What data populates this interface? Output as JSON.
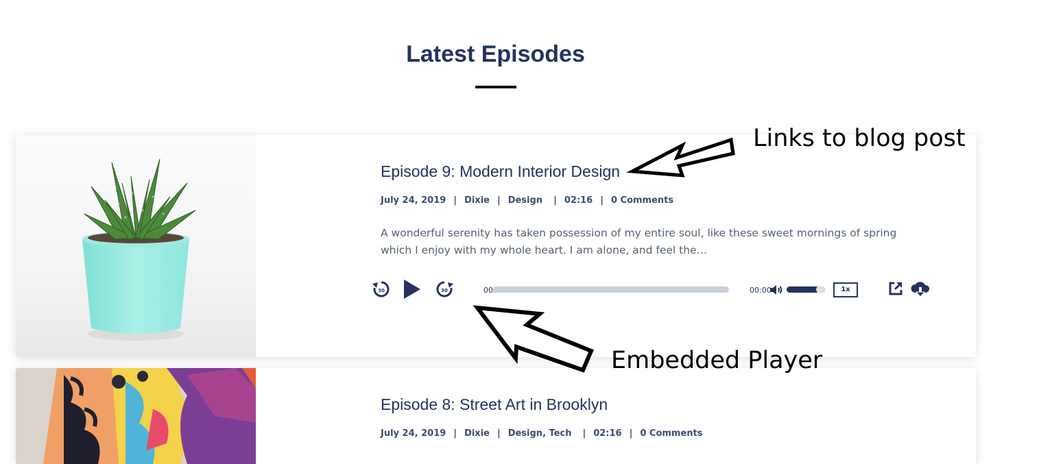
{
  "section": {
    "title": "Latest Episodes"
  },
  "episodes": [
    {
      "title": "Episode 9: Modern Interior Design",
      "date": "July 24, 2019",
      "author": "Dixie",
      "categories": "Design",
      "duration": "02:16",
      "comments": "0 Comments",
      "excerpt": "A wonderful serenity has taken possession of my entire soul, like these sweet mornings of spring which I enjoy with my whole heart. I am alone, and feel the…",
      "thumbnail": "succulent-in-mint-pot",
      "player": {
        "current_time": "00:00",
        "total_time": "00:00",
        "progress": 0,
        "volume": 0.85,
        "speed": "1x"
      }
    },
    {
      "title": "Episode 8: Street Art in Brooklyn",
      "date": "July 24, 2019",
      "author": "Dixie",
      "categories": "Design, Tech",
      "duration": "02:16",
      "comments": "0 Comments",
      "thumbnail": "colorful-street-art-mural"
    }
  ],
  "annotations": {
    "blog_link": "Links to blog post",
    "player": "Embedded Player"
  },
  "icons": {
    "rewind": "rewind-30-icon",
    "play": "play-icon",
    "forward": "forward-30-icon",
    "volume": "volume-icon",
    "share": "share-icon",
    "download": "cloud-download-icon"
  },
  "colors": {
    "primary": "#24335f",
    "text": "#556079",
    "track": "#c8d1db"
  }
}
